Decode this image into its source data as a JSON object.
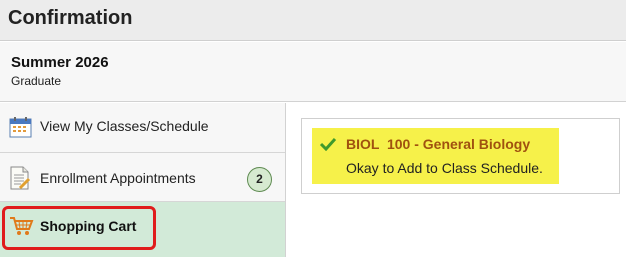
{
  "header": {
    "title": "Confirmation"
  },
  "term": {
    "name": "Summer 2026",
    "career": "Graduate"
  },
  "sidebar": {
    "items": [
      {
        "label": "View My Classes/Schedule",
        "icon": "calendar-icon"
      },
      {
        "label": "Enrollment Appointments",
        "icon": "document-icon",
        "badge": "2"
      },
      {
        "label": "Shopping Cart",
        "icon": "shopping-cart-icon",
        "selected": true
      }
    ]
  },
  "result": {
    "course": "BIOL  100 - General Biology",
    "message": "Okay to Add to Class Schedule.",
    "status_icon": "checkmark-icon"
  },
  "colors": {
    "selected_bg": "#d2ead8",
    "highlight": "#f6f14a",
    "course_text": "#a0510f",
    "focus_outline": "#e01c1c",
    "badge_bg": "#d6ead0"
  }
}
